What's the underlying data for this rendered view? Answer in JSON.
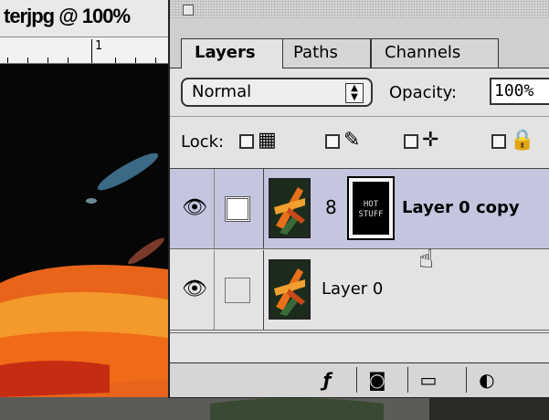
{
  "document": {
    "title": "terjpg @ 100%",
    "ruler_label": "1"
  },
  "palette": {
    "tabs": [
      {
        "label": "Layers",
        "active": true
      },
      {
        "label": "Paths",
        "active": false
      },
      {
        "label": "Channels",
        "active": false
      }
    ],
    "blend_mode": "Normal",
    "opacity_label": "Opacity:",
    "opacity_value": "100%",
    "lock_label": "Lock:",
    "lock_options": [
      {
        "icon": "lock-transparency-icon",
        "glyph": "▦"
      },
      {
        "icon": "lock-image-brush-icon",
        "glyph": "✎"
      },
      {
        "icon": "lock-position-move-icon",
        "glyph": "✛"
      },
      {
        "icon": "lock-all-padlock-icon",
        "glyph": "🔒"
      }
    ],
    "layers": [
      {
        "name": "Layer 0 copy",
        "visible": true,
        "selected": true,
        "mask_text": "HOT STUFF",
        "linked_icon": "chain-link-icon"
      },
      {
        "name": "Layer 0",
        "visible": true,
        "selected": false
      }
    ],
    "bottom_buttons": [
      {
        "icon": "add-layer-style-icon",
        "glyph": "ƒ"
      },
      {
        "icon": "add-mask-icon",
        "glyph": "◙"
      },
      {
        "icon": "new-layer-set-folder-icon",
        "glyph": "▭"
      },
      {
        "icon": "new-adjustment-layer-icon",
        "glyph": "◐"
      }
    ]
  },
  "colors": {
    "selected_row": "#c4c6e0",
    "palette_bg": "#e3e3e3"
  }
}
